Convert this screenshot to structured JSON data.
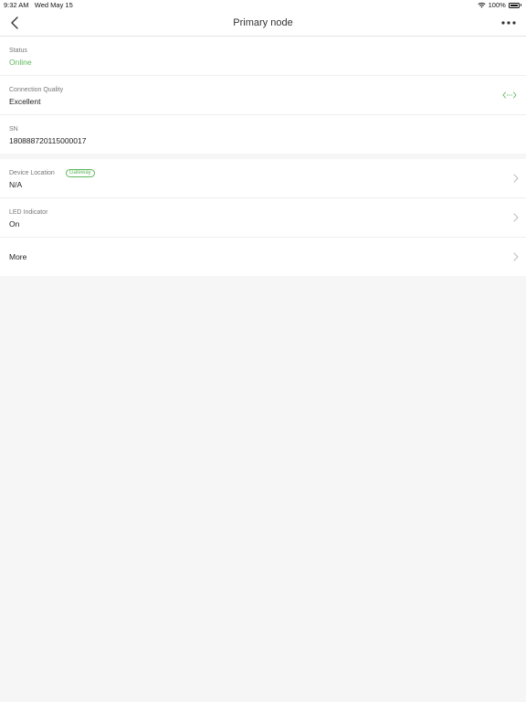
{
  "status_bar": {
    "time": "9:32 AM",
    "date": "Wed May 15",
    "battery": "100%"
  },
  "header": {
    "title": "Primary node"
  },
  "rows": {
    "status": {
      "label": "Status",
      "value": "Online",
      "value_color": "#5cb85c"
    },
    "connection": {
      "label": "Connection Quality",
      "value": "Excellent",
      "icon": "connection-quality-icon"
    },
    "sn": {
      "label": "SN",
      "value": "180888720115000017"
    },
    "location": {
      "label": "Device Location",
      "badge": "Gateway",
      "value": "N/A"
    },
    "led": {
      "label": "LED Indicator",
      "value": "On"
    },
    "more": {
      "label": "More"
    }
  },
  "colors": {
    "accent": "#5cb85c",
    "background": "#f6f6f7"
  }
}
